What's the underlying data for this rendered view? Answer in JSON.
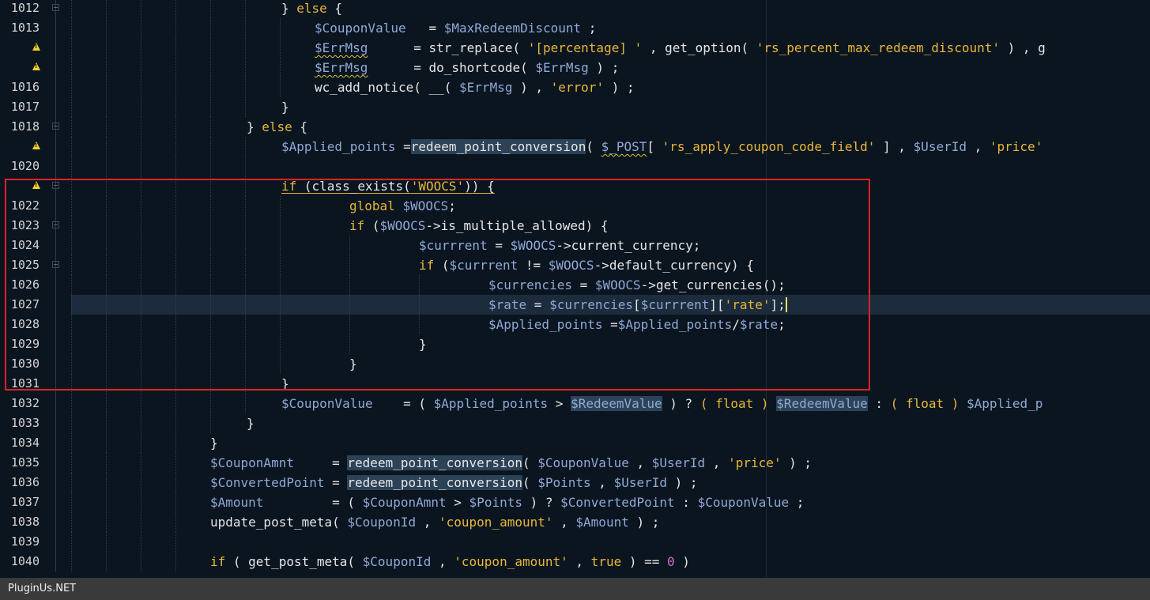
{
  "status_bar": {
    "text": "PluginUs.NET"
  },
  "lines": [
    {
      "num": "1012",
      "warn": false,
      "fold": true,
      "indent": 356,
      "guides": [
        90,
        134,
        178,
        222,
        266,
        310
      ],
      "tokens": [
        [
          "} ",
          "op"
        ],
        [
          "else",
          "kw"
        ],
        [
          " {",
          "op"
        ]
      ]
    },
    {
      "num": "1013",
      "warn": false,
      "fold": false,
      "indent": 398,
      "guides": [
        90,
        134,
        178,
        222,
        266,
        310,
        354
      ],
      "tokens": [
        [
          "$CouponValue",
          "var"
        ],
        [
          "   = ",
          "op"
        ],
        [
          "$MaxRedeemDiscount",
          "var"
        ],
        [
          " ;",
          "op"
        ]
      ]
    },
    {
      "num": "",
      "warn": true,
      "fold": false,
      "indent": 398,
      "guides": [
        90,
        134,
        178,
        222,
        266,
        310,
        354
      ],
      "tokens": [
        [
          "$ErrMsg",
          "var wavy"
        ],
        [
          "      = str_replace( ",
          "op"
        ],
        [
          "'[percentage] '",
          "str"
        ],
        [
          " , get_option( ",
          "op"
        ],
        [
          "'rs_percent_max_redeem_discount'",
          "str"
        ],
        [
          " ) , g",
          "op"
        ]
      ]
    },
    {
      "num": "",
      "warn": true,
      "fold": false,
      "indent": 398,
      "guides": [
        90,
        134,
        178,
        222,
        266,
        310,
        354
      ],
      "tokens": [
        [
          "$ErrMsg",
          "var wavy"
        ],
        [
          "      = do_shortcode( ",
          "op"
        ],
        [
          "$ErrMsg",
          "var"
        ],
        [
          " ) ;",
          "op"
        ]
      ]
    },
    {
      "num": "1016",
      "warn": false,
      "fold": false,
      "indent": 398,
      "guides": [
        90,
        134,
        178,
        222,
        266,
        310,
        354
      ],
      "tokens": [
        [
          "wc_add_notice( __( ",
          "op"
        ],
        [
          "$ErrMsg",
          "var"
        ],
        [
          " ) , ",
          "op"
        ],
        [
          "'error'",
          "str"
        ],
        [
          " ) ;",
          "op"
        ]
      ]
    },
    {
      "num": "1017",
      "warn": false,
      "fold": false,
      "indent": 356,
      "guides": [
        90,
        134,
        178,
        222,
        266,
        310
      ],
      "tokens": [
        [
          "}",
          "op"
        ]
      ]
    },
    {
      "num": "1018",
      "warn": false,
      "fold": true,
      "indent": 312,
      "guides": [
        90,
        134,
        178,
        222,
        266
      ],
      "tokens": [
        [
          "} ",
          "op"
        ],
        [
          "else",
          "kw"
        ],
        [
          " {",
          "op"
        ]
      ]
    },
    {
      "num": "",
      "warn": true,
      "fold": false,
      "indent": 356,
      "guides": [
        90,
        134,
        178,
        222,
        266,
        310
      ],
      "tokens": [
        [
          "$Applied_points",
          "var"
        ],
        [
          " =",
          "op"
        ],
        [
          "redeem_point_conversion",
          "fn sel"
        ],
        [
          "( ",
          "op"
        ],
        [
          "$_POST",
          "var wavy"
        ],
        [
          "[ ",
          "op"
        ],
        [
          "'rs_apply_coupon_code_field'",
          "str"
        ],
        [
          " ] , ",
          "op"
        ],
        [
          "$UserId",
          "var"
        ],
        [
          " , ",
          "op"
        ],
        [
          "'price'",
          "str"
        ]
      ]
    },
    {
      "num": "1020",
      "warn": false,
      "fold": false,
      "indent": 356,
      "guides": [
        90,
        134,
        178,
        222,
        266,
        310
      ],
      "tokens": []
    },
    {
      "num": "",
      "warn": true,
      "fold": true,
      "indent": 356,
      "guides": [
        90,
        134,
        178,
        222,
        266,
        310
      ],
      "tokens": [
        [
          "if",
          "kw ul"
        ],
        [
          " (class_exists(",
          "op ul"
        ],
        [
          "'WOOCS'",
          "str ul"
        ],
        [
          ")) {",
          "op ul"
        ]
      ]
    },
    {
      "num": "1022",
      "warn": false,
      "fold": false,
      "indent": 442,
      "guides": [
        90,
        134,
        178,
        222,
        266,
        310,
        354
      ],
      "tokens": [
        [
          "global",
          "kw"
        ],
        [
          " ",
          "op"
        ],
        [
          "$WOOCS",
          "var"
        ],
        [
          ";",
          "op"
        ]
      ]
    },
    {
      "num": "1023",
      "warn": false,
      "fold": true,
      "indent": 442,
      "guides": [
        90,
        134,
        178,
        222,
        266,
        310,
        354
      ],
      "tokens": [
        [
          "if",
          "kw"
        ],
        [
          " (",
          "op"
        ],
        [
          "$WOOCS",
          "var"
        ],
        [
          "->is_multiple_allowed) {",
          "op"
        ]
      ]
    },
    {
      "num": "1024",
      "warn": false,
      "fold": false,
      "indent": 530,
      "guides": [
        90,
        134,
        178,
        222,
        266,
        310,
        354,
        442
      ],
      "tokens": [
        [
          "$currrent",
          "var"
        ],
        [
          " = ",
          "op"
        ],
        [
          "$WOOCS",
          "var"
        ],
        [
          "->current_currency;",
          "op"
        ]
      ]
    },
    {
      "num": "1025",
      "warn": false,
      "fold": true,
      "indent": 530,
      "guides": [
        90,
        134,
        178,
        222,
        266,
        310,
        354,
        442
      ],
      "tokens": [
        [
          "if",
          "kw"
        ],
        [
          " (",
          "op"
        ],
        [
          "$currrent",
          "var"
        ],
        [
          " != ",
          "op"
        ],
        [
          "$WOOCS",
          "var"
        ],
        [
          "->default_currency) {",
          "op"
        ]
      ]
    },
    {
      "num": "1026",
      "warn": false,
      "fold": false,
      "indent": 618,
      "guides": [
        90,
        134,
        178,
        222,
        266,
        310,
        354,
        442,
        530
      ],
      "tokens": [
        [
          "$currencies",
          "var"
        ],
        [
          " = ",
          "op"
        ],
        [
          "$WOOCS",
          "var"
        ],
        [
          "->get_currencies();",
          "op"
        ]
      ]
    },
    {
      "num": "1027",
      "warn": false,
      "fold": false,
      "current": true,
      "indent": 618,
      "guides": [
        90,
        134,
        178,
        222,
        266,
        310,
        354,
        442,
        530
      ],
      "tokens": [
        [
          "$rate",
          "var"
        ],
        [
          " = ",
          "op"
        ],
        [
          "$currencies",
          "var"
        ],
        [
          "[",
          "op"
        ],
        [
          "$currrent",
          "var"
        ],
        [
          "][",
          "op"
        ],
        [
          "'rate'",
          "str"
        ],
        [
          "];",
          "op cursor"
        ]
      ]
    },
    {
      "num": "1028",
      "warn": false,
      "fold": false,
      "indent": 618,
      "guides": [
        90,
        134,
        178,
        222,
        266,
        310,
        354,
        442,
        530
      ],
      "tokens": [
        [
          "$Applied_points",
          "var"
        ],
        [
          " =",
          "op"
        ],
        [
          "$Applied_points",
          "var"
        ],
        [
          "/",
          "op"
        ],
        [
          "$rate",
          "var"
        ],
        [
          ";",
          "op"
        ]
      ]
    },
    {
      "num": "1029",
      "warn": false,
      "fold": false,
      "indent": 530,
      "guides": [
        90,
        134,
        178,
        222,
        266,
        310,
        354,
        442
      ],
      "tokens": [
        [
          "}",
          "op"
        ]
      ]
    },
    {
      "num": "1030",
      "warn": false,
      "fold": false,
      "indent": 442,
      "guides": [
        90,
        134,
        178,
        222,
        266,
        310,
        354
      ],
      "tokens": [
        [
          "}",
          "op"
        ]
      ]
    },
    {
      "num": "1031",
      "warn": false,
      "fold": false,
      "indent": 356,
      "guides": [
        90,
        134,
        178,
        222,
        266,
        310
      ],
      "tokens": [
        [
          "}",
          "op"
        ]
      ]
    },
    {
      "num": "1032",
      "warn": false,
      "fold": false,
      "indent": 356,
      "guides": [
        90,
        134,
        178,
        222,
        266,
        310
      ],
      "tokens": [
        [
          "$CouponValue",
          "var"
        ],
        [
          "    = ( ",
          "op"
        ],
        [
          "$Applied_points",
          "var"
        ],
        [
          " > ",
          "op"
        ],
        [
          "$RedeemValue",
          "var sel"
        ],
        [
          " ) ? ",
          "op"
        ],
        [
          "( float )",
          "kw"
        ],
        [
          " ",
          "op"
        ],
        [
          "$RedeemValue",
          "var sel"
        ],
        [
          " : ",
          "op"
        ],
        [
          "( float )",
          "kw"
        ],
        [
          " ",
          "op"
        ],
        [
          "$Applied_p",
          "var"
        ]
      ]
    },
    {
      "num": "1033",
      "warn": false,
      "fold": false,
      "indent": 312,
      "guides": [
        90,
        134,
        178,
        222,
        266
      ],
      "tokens": [
        [
          "}",
          "op"
        ]
      ]
    },
    {
      "num": "1034",
      "warn": false,
      "fold": false,
      "indent": 266,
      "guides": [
        90,
        134,
        178,
        222
      ],
      "tokens": [
        [
          "}",
          "op"
        ]
      ]
    },
    {
      "num": "1035",
      "warn": false,
      "fold": false,
      "indent": 266,
      "guides": [
        90,
        134,
        178,
        222
      ],
      "tokens": [
        [
          "$CouponAmnt",
          "var"
        ],
        [
          "     = ",
          "op"
        ],
        [
          "redeem_point_conversion",
          "fn sel"
        ],
        [
          "( ",
          "op"
        ],
        [
          "$CouponValue",
          "var"
        ],
        [
          " , ",
          "op"
        ],
        [
          "$UserId",
          "var"
        ],
        [
          " , ",
          "op"
        ],
        [
          "'price'",
          "str"
        ],
        [
          " ) ;",
          "op"
        ]
      ]
    },
    {
      "num": "1036",
      "warn": false,
      "fold": false,
      "indent": 266,
      "guides": [
        90,
        134,
        178,
        222
      ],
      "tokens": [
        [
          "$ConvertedPoint",
          "var"
        ],
        [
          " = ",
          "op"
        ],
        [
          "redeem_point_conversion",
          "fn sel"
        ],
        [
          "( ",
          "op"
        ],
        [
          "$Points",
          "var"
        ],
        [
          " , ",
          "op"
        ],
        [
          "$UserId",
          "var"
        ],
        [
          " ) ;",
          "op"
        ]
      ]
    },
    {
      "num": "1037",
      "warn": false,
      "fold": false,
      "indent": 266,
      "guides": [
        90,
        134,
        178,
        222
      ],
      "tokens": [
        [
          "$Amount",
          "var"
        ],
        [
          "         = ( ",
          "op"
        ],
        [
          "$CouponAmnt",
          "var"
        ],
        [
          " > ",
          "op"
        ],
        [
          "$Points",
          "var"
        ],
        [
          " ) ? ",
          "op"
        ],
        [
          "$ConvertedPoint",
          "var"
        ],
        [
          " : ",
          "op"
        ],
        [
          "$CouponValue",
          "var"
        ],
        [
          " ;",
          "op"
        ]
      ]
    },
    {
      "num": "1038",
      "warn": false,
      "fold": false,
      "indent": 266,
      "guides": [
        90,
        134,
        178,
        222
      ],
      "tokens": [
        [
          "update_post_meta( ",
          "op"
        ],
        [
          "$CouponId",
          "var"
        ],
        [
          " , ",
          "op"
        ],
        [
          "'coupon_amount'",
          "str"
        ],
        [
          " , ",
          "op"
        ],
        [
          "$Amount",
          "var"
        ],
        [
          " ) ;",
          "op"
        ]
      ]
    },
    {
      "num": "1039",
      "warn": false,
      "fold": false,
      "indent": 266,
      "guides": [
        90,
        134,
        178,
        222
      ],
      "tokens": []
    },
    {
      "num": "1040",
      "warn": false,
      "fold": false,
      "indent": 266,
      "guides": [
        90,
        134,
        178,
        222
      ],
      "tokens": [
        [
          "if",
          "kw"
        ],
        [
          " ( get_post_meta( ",
          "op"
        ],
        [
          "$CouponId",
          "var"
        ],
        [
          " , ",
          "op"
        ],
        [
          "'coupon_amount'",
          "str"
        ],
        [
          " , ",
          "op"
        ],
        [
          "true",
          "kw"
        ],
        [
          " ) == ",
          "op"
        ],
        [
          "0",
          "num"
        ],
        [
          " )",
          "op"
        ]
      ]
    }
  ]
}
